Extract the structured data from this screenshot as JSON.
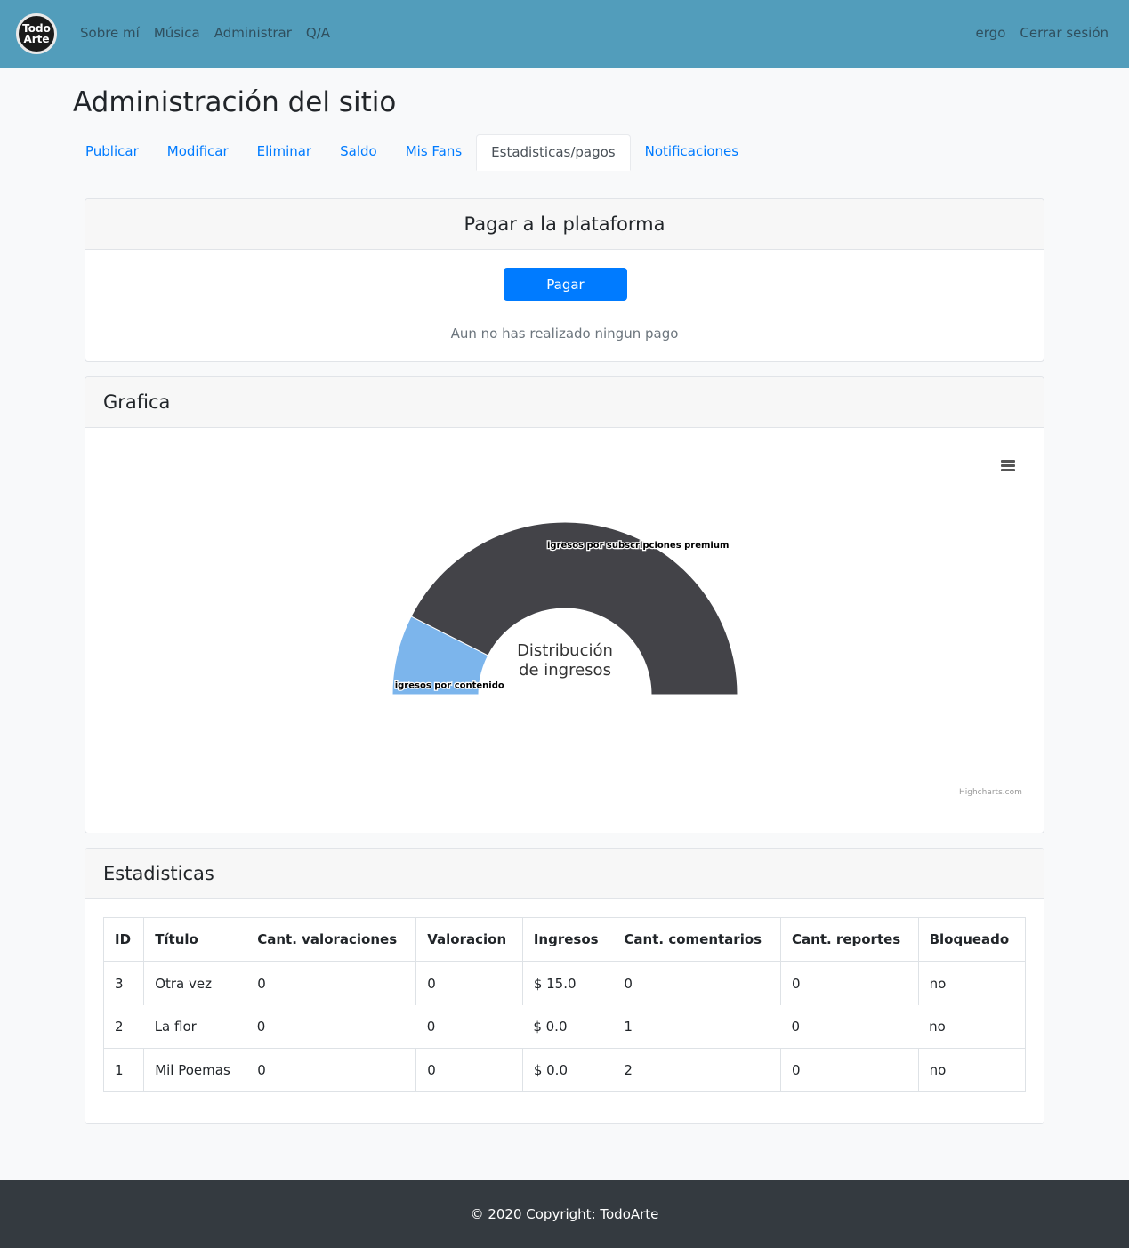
{
  "navbar": {
    "logo_top": "Todo",
    "logo_bottom": "Arte",
    "links": [
      "Sobre mí",
      "Música",
      "Administrar",
      "Q/A"
    ],
    "user": "ergo",
    "logout": "Cerrar sesión"
  },
  "page": {
    "title": "Administración del sitio",
    "tabs": [
      "Publicar",
      "Modificar",
      "Eliminar",
      "Saldo",
      "Mis Fans",
      "Estadisticas/pagos",
      "Notificaciones"
    ]
  },
  "pay_card": {
    "title": "Pagar a la plataforma",
    "button": "Pagar",
    "note": "Aun no has realizado ningun pago"
  },
  "chart_card": {
    "title": "Grafica",
    "menu_icon": "hamburger-menu-icon",
    "credit": "Highcharts.com"
  },
  "chart_data": {
    "type": "pie",
    "variant": "semi-circle donut",
    "title": "Distribución de ingresos",
    "center_title_lines": [
      "Distribución",
      "de ingresos"
    ],
    "slices": [
      {
        "label": "igresos por contenido",
        "value": 15,
        "color": "#7cb5ec"
      },
      {
        "label": "igresos por subscripciones premium",
        "value": 85,
        "color": "#434348"
      }
    ]
  },
  "stats_card": {
    "title": "Estadisticas",
    "columns": [
      "ID",
      "Título",
      "Cant. valoraciones",
      "Valoracion",
      "Ingresos",
      "Cant. comentarios",
      "Cant. reportes",
      "Bloqueado"
    ],
    "rows": [
      [
        "3",
        "Otra vez",
        "0",
        "0",
        "$ 15.0",
        "0",
        "0",
        "no"
      ],
      [
        "2",
        "La flor",
        "0",
        "0",
        "$ 0.0",
        "1",
        "0",
        "no"
      ],
      [
        "1",
        "Mil Poemas",
        "0",
        "0",
        "$ 0.0",
        "2",
        "0",
        "no"
      ]
    ]
  },
  "footer": {
    "text": "© 2020 Copyright: TodoArte"
  }
}
